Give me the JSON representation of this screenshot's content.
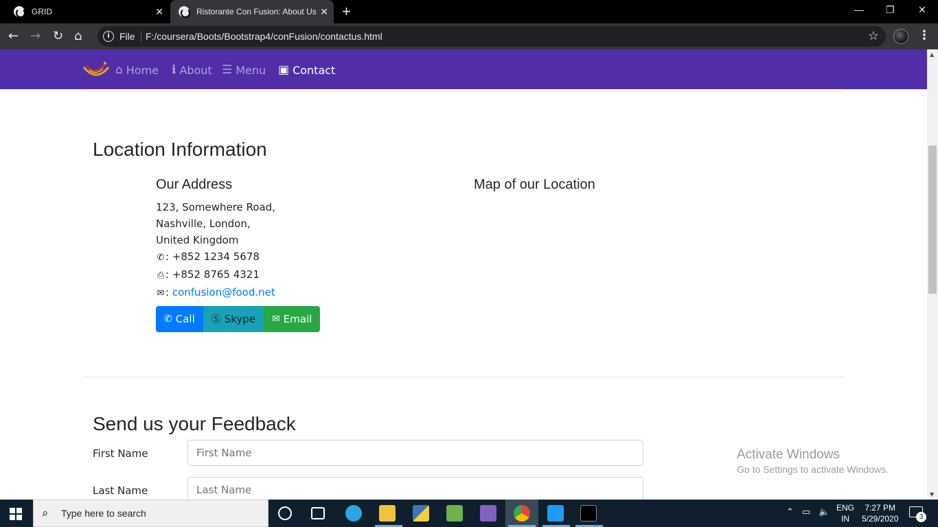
{
  "browser": {
    "tabs": [
      {
        "title": "GRID",
        "active": false
      },
      {
        "title": "Ristorante Con Fusion: About Us",
        "active": true
      }
    ],
    "new_tab": "+",
    "window_controls": {
      "minimize": "—",
      "restore": "❐",
      "close": "✕"
    },
    "address": {
      "scheme_label": "File",
      "url": "F:/coursera/Boots/Bootstrap4/conFusion/contactus.html"
    },
    "colors": {
      "tabbar": "#000000",
      "toolbar": "#35363a"
    }
  },
  "navbar": {
    "color": "#512da8",
    "items": [
      {
        "label": "Home",
        "icon": "home-icon",
        "glyph": "⌂",
        "active": false
      },
      {
        "label": "About",
        "icon": "info-icon",
        "glyph": "ℹ",
        "active": false
      },
      {
        "label": "Menu",
        "icon": "list-icon",
        "glyph": "☰",
        "active": false
      },
      {
        "label": "Contact",
        "icon": "address-card-icon",
        "glyph": "▣",
        "active": true
      }
    ]
  },
  "location": {
    "heading": "Location Information",
    "address_heading": "Our Address",
    "address_lines": [
      "123, Somewhere Road,",
      "Nashville, London,",
      "United Kingdom"
    ],
    "phone": {
      "icon": "phone-icon",
      "glyph": "✆",
      "value": ": +852 1234 5678"
    },
    "fax": {
      "icon": "fax-icon",
      "glyph": "⎙",
      "value": ": +852 8765 4321"
    },
    "email": {
      "icon": "envelope-icon",
      "glyph": "✉",
      "prefix": ":",
      "value": "confusion@food.net"
    },
    "map_heading": "Map of our Location",
    "buttons": [
      {
        "label": "Call",
        "icon": "phone-icon",
        "glyph": "✆",
        "color": "#007bff"
      },
      {
        "label": "Skype",
        "icon": "skype-icon",
        "glyph": "Ⓢ",
        "color": "#17a2b8"
      },
      {
        "label": "Email",
        "icon": "envelope-icon",
        "glyph": "✉",
        "color": "#28a745"
      }
    ]
  },
  "feedback": {
    "heading": "Send us your Feedback",
    "fields": [
      {
        "label": "First Name",
        "placeholder": "First Name"
      },
      {
        "label": "Last Name",
        "placeholder": "Last Name"
      }
    ]
  },
  "watermark": {
    "line1": "Activate Windows",
    "line2": "Go to Settings to activate Windows."
  },
  "taskbar": {
    "search_placeholder": "Type here to search",
    "language": {
      "line1": "ENG",
      "line2": "IN"
    },
    "clock": {
      "time": "7:27 PM",
      "date": "5/29/2020"
    },
    "notification_count": "3"
  }
}
